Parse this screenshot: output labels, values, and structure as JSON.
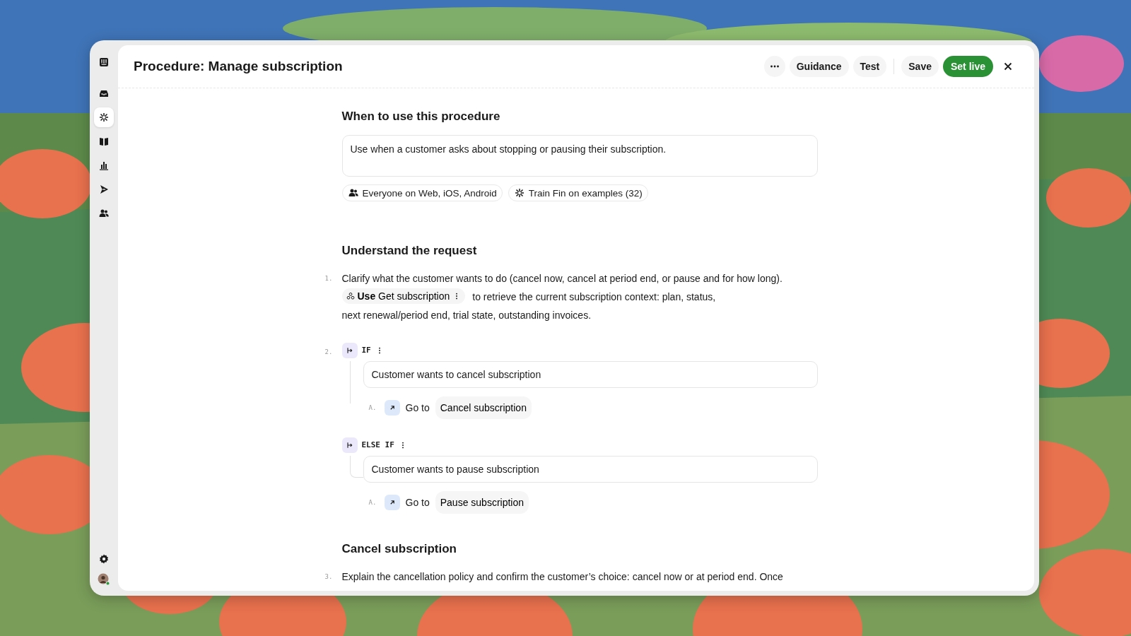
{
  "sidebar": {
    "top": [
      {
        "kind": "logo",
        "selected": false
      },
      {
        "kind": "inbox",
        "selected": false
      },
      {
        "kind": "fin",
        "selected": true
      },
      {
        "kind": "book",
        "selected": false
      },
      {
        "kind": "chart",
        "selected": false
      },
      {
        "kind": "send",
        "selected": false
      },
      {
        "kind": "people",
        "selected": false
      }
    ],
    "bottom": [
      {
        "kind": "settings"
      },
      {
        "kind": "avatar"
      }
    ]
  },
  "header": {
    "title": "Procedure: Manage subscription",
    "buttons": [
      {
        "kind": "more"
      },
      {
        "kind": "ghost",
        "label": "Guidance"
      },
      {
        "kind": "ghost",
        "label": "Test"
      },
      {
        "kind": "divider"
      },
      {
        "kind": "ghost",
        "label": "Save"
      },
      {
        "kind": "primary",
        "label": "Set live"
      },
      {
        "kind": "close"
      }
    ]
  },
  "when": {
    "heading": "When to use this procedure",
    "description": "Use when a customer asks about stopping or pausing their subscription.",
    "chips": [
      {
        "kind": "audience",
        "label": "Everyone on Web, iOS, Android"
      },
      {
        "kind": "training",
        "label": "Train Fin on examples (32)"
      }
    ]
  },
  "sections": [
    {
      "heading": "Understand the request",
      "steps": [
        {
          "kind": "text",
          "number": "1.",
          "text": "Clarify what the customer wants to do (cancel now, cancel at period end, or pause and for how long).",
          "tool": "**Use** Get subscription",
          "after_tool": "to retrieve the current subscription context: plan, status,",
          "continuation": "next renewal/period end, trial state, outstanding invoices."
        },
        {
          "kind": "branch",
          "number": "2.",
          "branches": [
            {
              "keyword": "IF",
              "condition": "Customer wants to cancel subscription",
              "actions": [
                {
                  "letter": "A.",
                  "verb": "Go to",
                  "target": "Cancel subscription"
                }
              ]
            },
            {
              "keyword": "ELSE IF",
              "condition": "Customer wants to pause subscription",
              "actions": [
                {
                  "letter": "A.",
                  "verb": "Go to",
                  "target": "Pause subscription"
                }
              ]
            }
          ]
        }
      ]
    },
    {
      "heading": "Cancel subscription",
      "steps": [
        {
          "kind": "text",
          "number": "3.",
          "text": "Explain the cancellation policy and confirm the customer’s choice: cancel now or at period end. Once"
        }
      ]
    }
  ]
}
